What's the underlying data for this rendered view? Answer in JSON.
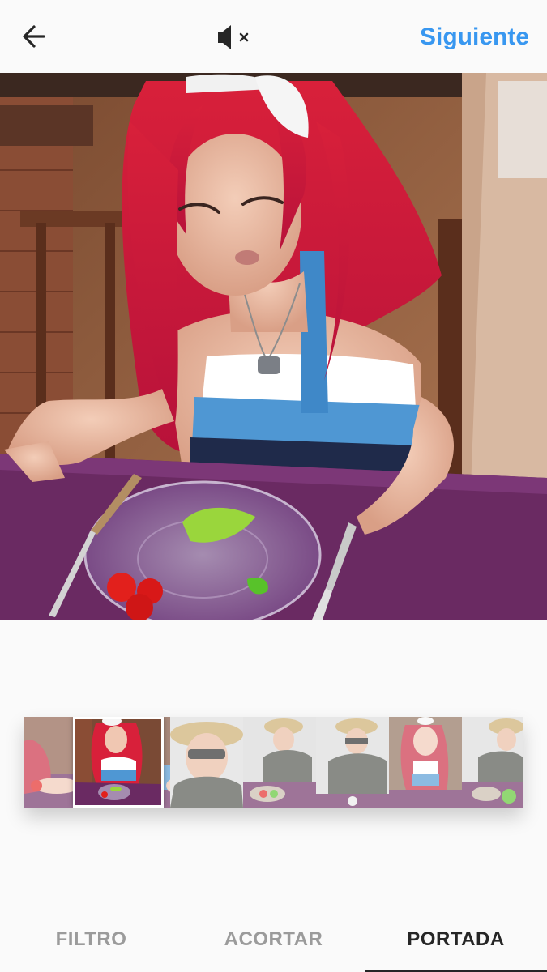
{
  "header": {
    "back_icon": "arrow-left-icon",
    "mute_icon": "speaker-muted-icon",
    "next_label": "Siguiente"
  },
  "preview": {
    "description_icon": "video-frame"
  },
  "filmstrip": {
    "frames": [
      "frame-1",
      "frame-2",
      "frame-3",
      "frame-4",
      "frame-5",
      "frame-6",
      "frame-7",
      "frame-8"
    ],
    "selected_index": 1
  },
  "tabs": [
    {
      "label": "FILTRO",
      "active": false
    },
    {
      "label": "ACORTAR",
      "active": false
    },
    {
      "label": "PORTADA",
      "active": true
    }
  ],
  "colors": {
    "accent": "#3897f0",
    "active_tab": "#262626",
    "inactive_tab": "#9b9b9b",
    "background": "#fafafa"
  }
}
